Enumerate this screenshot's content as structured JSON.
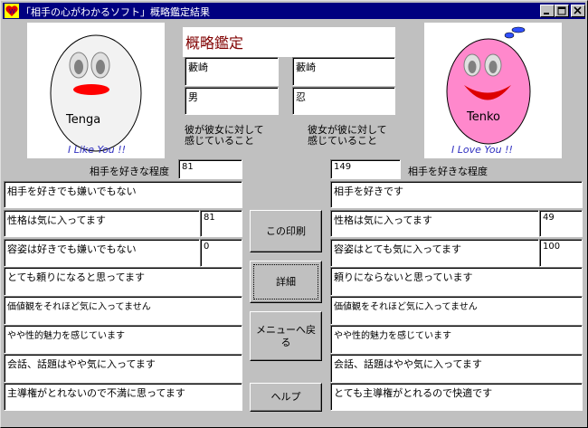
{
  "window": {
    "title": "「相手の心がわかるソフト」概略鑑定結果",
    "icon": "app-heart-icon",
    "controls": [
      "minimize-icon",
      "maximize-icon",
      "close-icon"
    ]
  },
  "left_face": {
    "name": "Tenga",
    "caption": "I Like You !!",
    "color": "#f2f2f2",
    "mouth_color": "#ff0000"
  },
  "right_face": {
    "name": "Tenko",
    "caption": "I Love You !!",
    "color": "#ff88cc",
    "mouth_color": "#dd0000"
  },
  "header": {
    "title": "概略鑑定",
    "left_surname": "藪崎",
    "left_given": "男",
    "right_surname": "藪崎",
    "right_given": "忍",
    "left_caption_1": "彼が彼女に対して",
    "left_caption_2": "感じていること",
    "right_caption_1": "彼女が彼に対して",
    "right_caption_2": "感じていること"
  },
  "left": {
    "like_label": "相手を好きな程度",
    "like_value": "81",
    "rows": [
      "相手を好きでも嫌いでもない",
      "性格は気に入ってます",
      "容姿は好きでも嫌いでもない",
      "とても頼りになると思ってます",
      "価値観をそれほど気に入ってません",
      "やや性的魅力を感じています",
      "会話、話題はやや気に入ってます",
      "主導権がとれないので不満に思ってます"
    ],
    "personality_value": "81",
    "appearance_value": "0"
  },
  "right": {
    "like_label": "相手を好きな程度",
    "like_value": "149",
    "rows": [
      "相手を好きです",
      "性格は気に入ってます",
      "容姿はとても気に入ってます",
      "頼りにならないと思っています",
      "価値観をそれほど気に入ってません",
      "やや性的魅力を感じています",
      "会話、話題はやや気に入ってます",
      "とても主導権がとれるので快適です"
    ],
    "personality_value": "49",
    "appearance_value": "100"
  },
  "buttons": {
    "print": "この印刷",
    "detail": "詳細",
    "menu_1": "メニューへ戻",
    "menu_2": "る",
    "help": "ヘルプ"
  }
}
